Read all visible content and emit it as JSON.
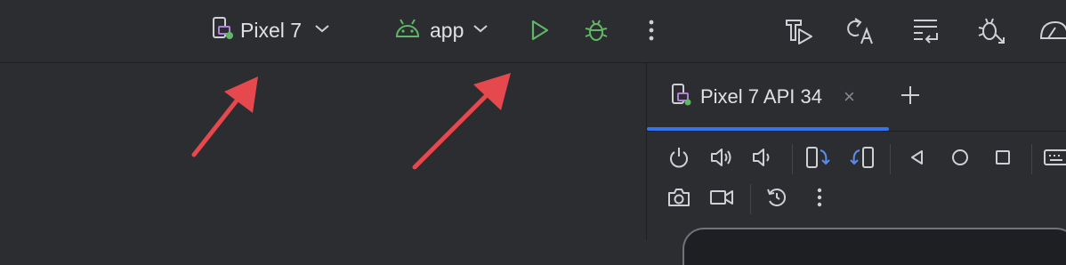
{
  "toolbar": {
    "device": "Pixel 7",
    "run_config": "app"
  },
  "emulator": {
    "tab_label": "Pixel 7 API 34",
    "tab_close": "×",
    "add_tab": "+"
  },
  "colors": {
    "bg": "#2b2d30",
    "accent_blue": "#3574f0",
    "run_green": "#5fb865",
    "android_green": "#5fb865",
    "arrow_red": "#e5484d"
  },
  "icons": [
    "device-icon",
    "chevron-down-icon",
    "android-icon",
    "run-icon",
    "debug-icon",
    "more-vert-icon",
    "build-icon",
    "code-translate-icon",
    "sync-icon",
    "bug-arrow-icon",
    "power-icon",
    "volume-up-icon",
    "volume-down-icon",
    "rotate-left-icon",
    "rotate-right-icon",
    "back-icon",
    "home-icon",
    "overview-icon",
    "keyboard-icon",
    "camera-icon",
    "record-icon",
    "reset-icon"
  ]
}
